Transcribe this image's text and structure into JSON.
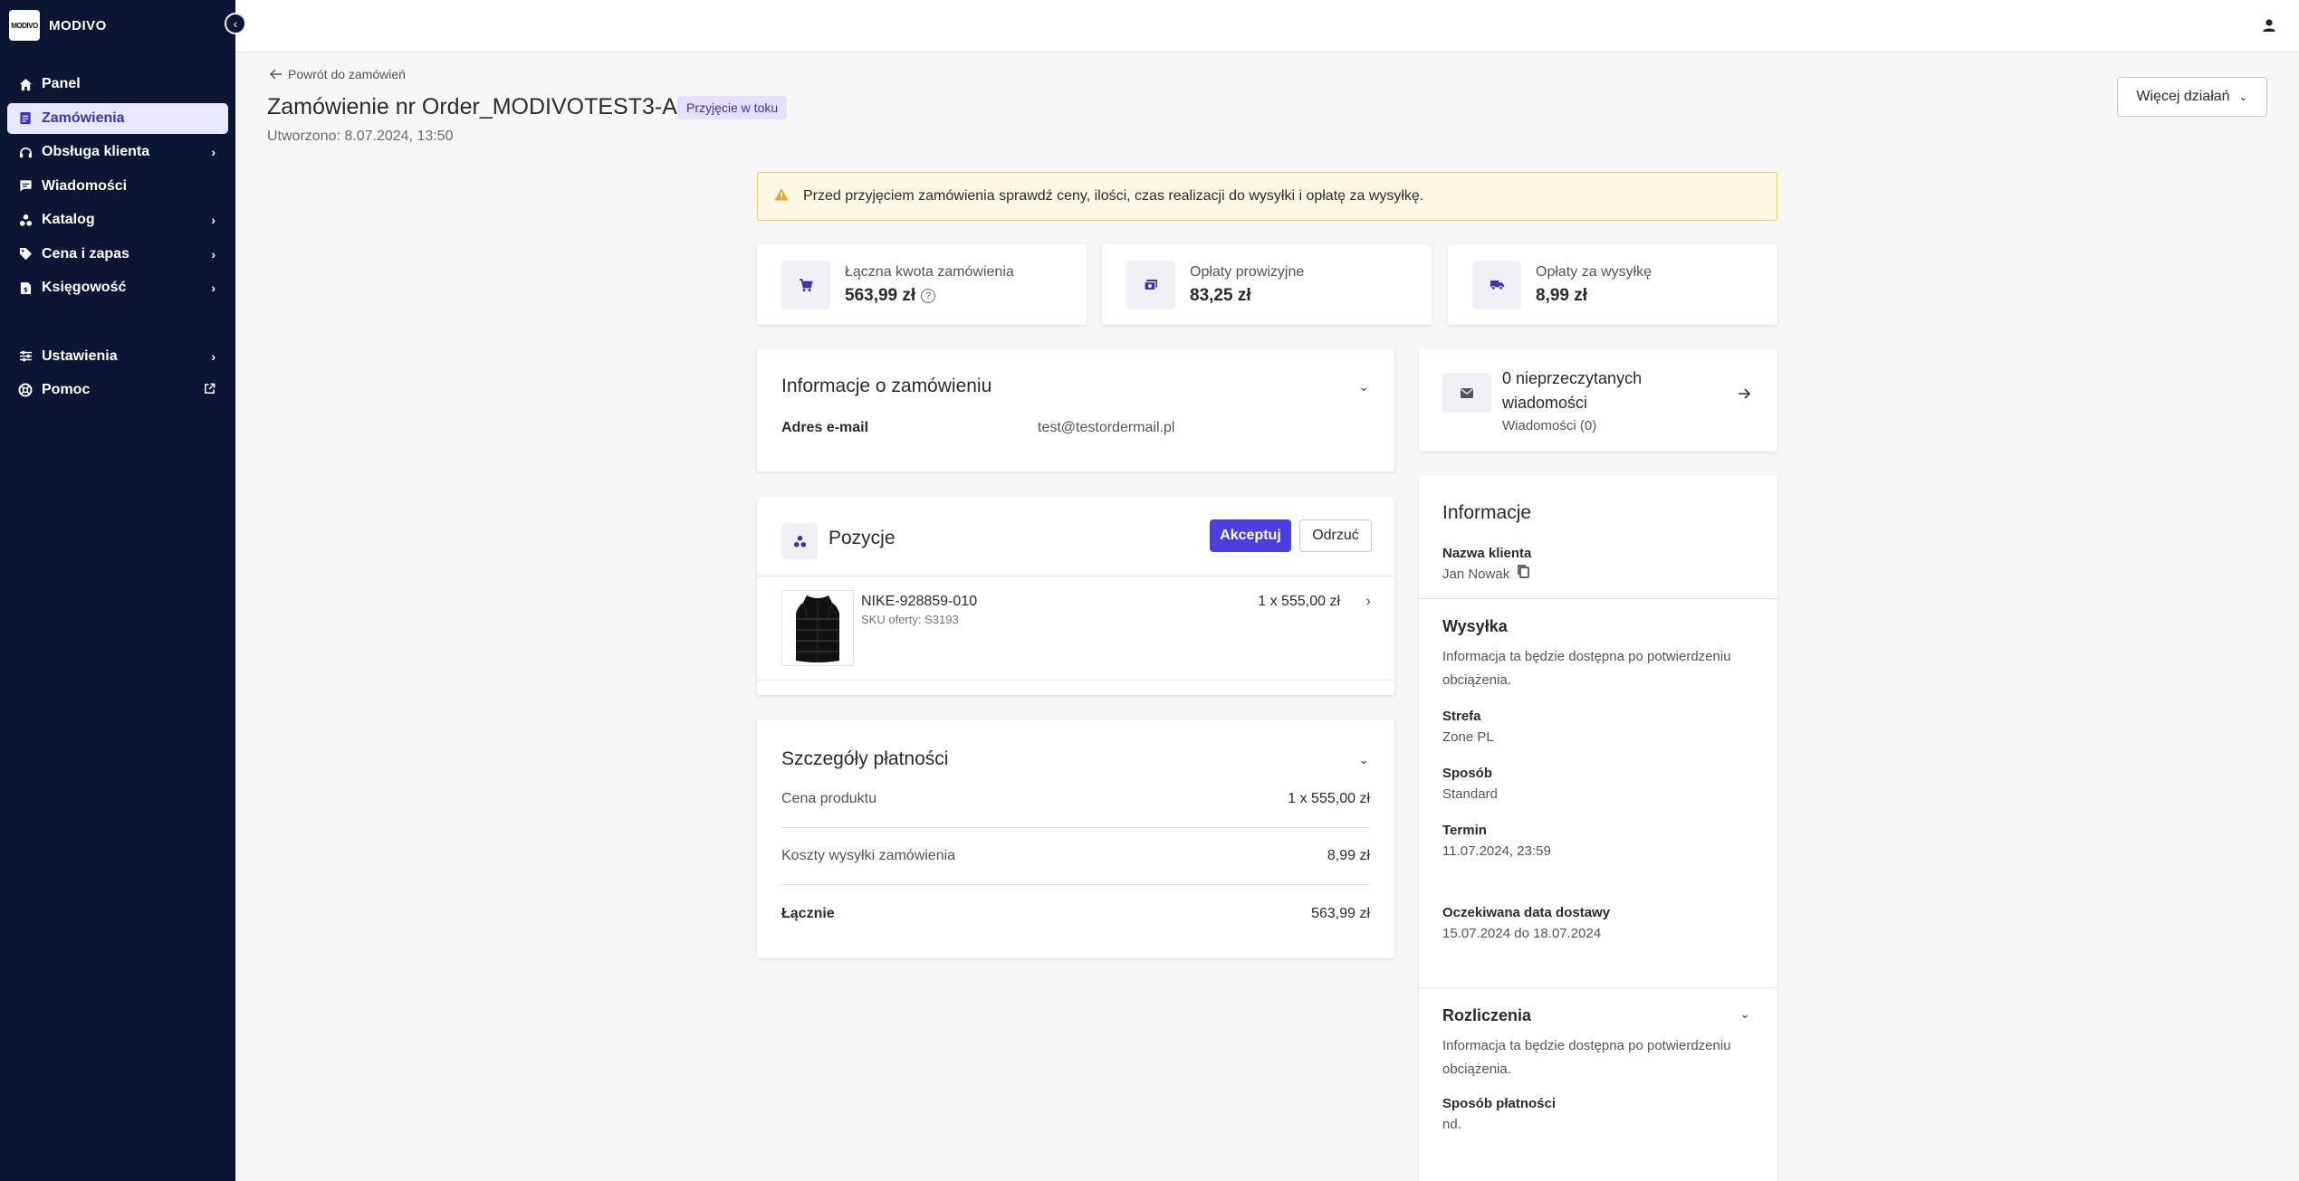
{
  "brand": {
    "logo_text": "MODIVO",
    "name": "MODIVO"
  },
  "sidebar": {
    "items": [
      {
        "label": "Panel",
        "icon": "home-icon"
      },
      {
        "label": "Zamówienia",
        "icon": "orders-icon",
        "active": true
      },
      {
        "label": "Obsługa klienta",
        "icon": "support-icon",
        "expandable": true
      },
      {
        "label": "Wiadomości",
        "icon": "message-icon"
      },
      {
        "label": "Katalog",
        "icon": "catalog-icon",
        "expandable": true
      },
      {
        "label": "Cena i zapas",
        "icon": "tag-icon",
        "expandable": true
      },
      {
        "label": "Księgowość",
        "icon": "accounting-icon",
        "expandable": true
      }
    ],
    "bottom_items": [
      {
        "label": "Ustawienia",
        "icon": "settings-icon",
        "expandable": true
      },
      {
        "label": "Pomoc",
        "icon": "help-icon",
        "external": true
      }
    ]
  },
  "header": {
    "back_label": "Powrót do zamówień",
    "title": "Zamówienie nr Order_MODIVOTEST3-A",
    "status_badge": "Przyjęcie w toku",
    "created": "Utworzono: 8.07.2024, 13:50",
    "more_actions": "Więcej działań"
  },
  "alert": {
    "text": "Przed przyjęciem zamówienia sprawdź ceny, ilości, czas realizacji do wysyłki i opłatę za wysyłkę."
  },
  "stats": [
    {
      "label": "Łączna kwota zamówienia",
      "value": "563,99 zł",
      "icon": "cart-icon"
    },
    {
      "label": "Opłaty prowizyjne",
      "value": "83,25 zł",
      "icon": "money-icon"
    },
    {
      "label": "Opłaty za wysyłkę",
      "value": "8,99 zł",
      "icon": "truck-icon"
    }
  ],
  "order_info": {
    "title": "Informacje o zamówieniu",
    "email_label": "Adres e-mail",
    "email_value": "test@testordermail.pl"
  },
  "positions": {
    "title": "Pozycje",
    "accept_label": "Akceptuj",
    "reject_label": "Odrzuć",
    "items": [
      {
        "name": "NIKE-928859-010",
        "sku": "SKU oferty: S3193",
        "price": "1 x 555,00 zł"
      }
    ]
  },
  "payment": {
    "title": "Szczegóły płatności",
    "rows": [
      {
        "label": "Cena produktu",
        "value": "1 x 555,00 zł"
      },
      {
        "label": "Koszty wysyłki zamówienia",
        "value": "8,99 zł"
      },
      {
        "label": "Łącznie",
        "value": "563,99 zł"
      }
    ]
  },
  "messages": {
    "title": "0 nieprzeczytanych wiadomości",
    "subtitle": "Wiadomości (0)"
  },
  "info_panel": {
    "title": "Informacje",
    "client_label": "Nazwa klienta",
    "client_value": "Jan Nowak",
    "shipping_title": "Wysyłka",
    "shipping_note": "Informacja ta będzie dostępna po potwierdzeniu obciążenia.",
    "zone_label": "Strefa",
    "zone_value": "Zone PL",
    "method_label": "Sposób",
    "method_value": "Standard",
    "deadline_label": "Termin",
    "deadline_value": "11.07.2024, 23:59",
    "delivery_label": "Oczekiwana data dostawy",
    "delivery_value": "15.07.2024 do 18.07.2024",
    "billing_title": "Rozliczenia",
    "billing_note": "Informacja ta będzie dostępna po potwierdzeniu obciążenia.",
    "payment_method_label": "Sposób płatności",
    "payment_method_value": "nd."
  },
  "colors": {
    "sidebar_bg": "#0b1633",
    "accent": "#4b3fe0",
    "active_bg": "#e7e8fd",
    "badge_bg": "#e5e0fb",
    "alert_bg": "#fdf8e6"
  }
}
